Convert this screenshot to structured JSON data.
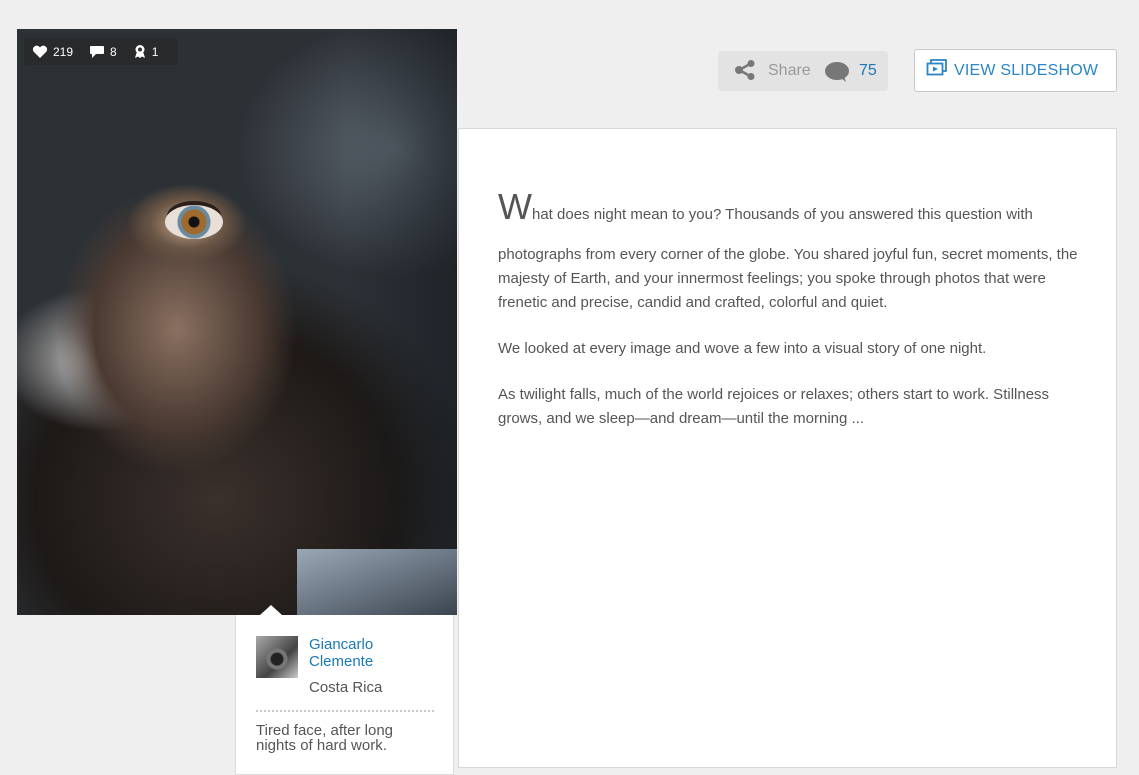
{
  "photo": {
    "stats": {
      "likes": "219",
      "comments": "8",
      "awards": "1"
    }
  },
  "author": {
    "name": "Giancarlo Clemente",
    "location": "Costa Rica",
    "caption": "Tired face, after long nights of hard work."
  },
  "actions": {
    "share_label": "Share",
    "comment_count": "75",
    "slideshow_label": "VIEW SLIDESHOW"
  },
  "article": {
    "dropcap": "W",
    "first_line_rest": "hat does night mean to you? Thousands of you answered this question with",
    "p1_rest": "photographs from every corner of the globe. You shared joyful fun, secret moments, the majesty of Earth, and your innermost feelings; you spoke through photos that were frenetic and precise, candid and crafted, colorful and quiet.",
    "p2": "We looked at every image and wove a few into a visual story of one night.",
    "p3": "As twilight falls, much of the world rejoices or relaxes; others start to work. Stillness grows, and we sleep—and dream—until the morning ..."
  },
  "icons": {
    "heart": "heart-icon",
    "comment": "comment-icon",
    "award": "award-icon",
    "share": "share-icon",
    "slideshow": "slideshow-icon"
  },
  "colors": {
    "link": "#1a78b8",
    "button_text": "#2a86c6",
    "background": "#efefef"
  }
}
